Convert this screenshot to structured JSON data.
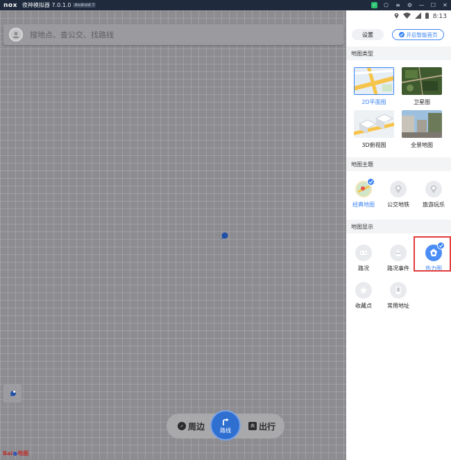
{
  "titlebar": {
    "logo": "nox",
    "title": "夜神模拟器 7.0.1.0",
    "version_badge": "Android 7",
    "icons": [
      "wechat-icon",
      "shirt-icon",
      "menu-icon",
      "gear-icon",
      "minimize-icon",
      "maximize-icon",
      "close-icon"
    ]
  },
  "map": {
    "search_placeholder": "搜地点、查公交、找路线",
    "bottom_nav": {
      "around_label": "周边",
      "route_label": "路线",
      "go_label": "出行"
    },
    "brand_logo": "Bai",
    "brand_logo_suffix": "地图"
  },
  "statusbar": {
    "time": "8:13",
    "icons": [
      "location-icon",
      "wifi-icon",
      "signal-icon",
      "battery-icon"
    ]
  },
  "panel": {
    "settings_label": "设置",
    "smart_home_label": "开启智能首页",
    "sections": {
      "map_type": "地图类型",
      "map_theme": "地图主题",
      "map_display": "地图显示"
    },
    "map_types": [
      {
        "label": "2D平面图",
        "selected": true
      },
      {
        "label": "卫星图",
        "selected": false
      },
      {
        "label": "3D俯视图",
        "selected": false
      },
      {
        "label": "全景地图",
        "selected": false
      }
    ],
    "themes": [
      {
        "label": "经典地图",
        "selected": true
      },
      {
        "label": "公交地铁",
        "selected": false
      },
      {
        "label": "旅游玩乐",
        "selected": false
      }
    ],
    "display_options": [
      {
        "label": "路况",
        "selected": false
      },
      {
        "label": "路况事件",
        "selected": false
      },
      {
        "label": "热力图",
        "selected": true
      },
      {
        "label": "收藏点",
        "selected": false
      },
      {
        "label": "常用地址",
        "selected": false
      }
    ]
  },
  "colors": {
    "accent": "#3a83f5",
    "route_button": "#2f6fd0",
    "highlight": "#e23b3b"
  }
}
